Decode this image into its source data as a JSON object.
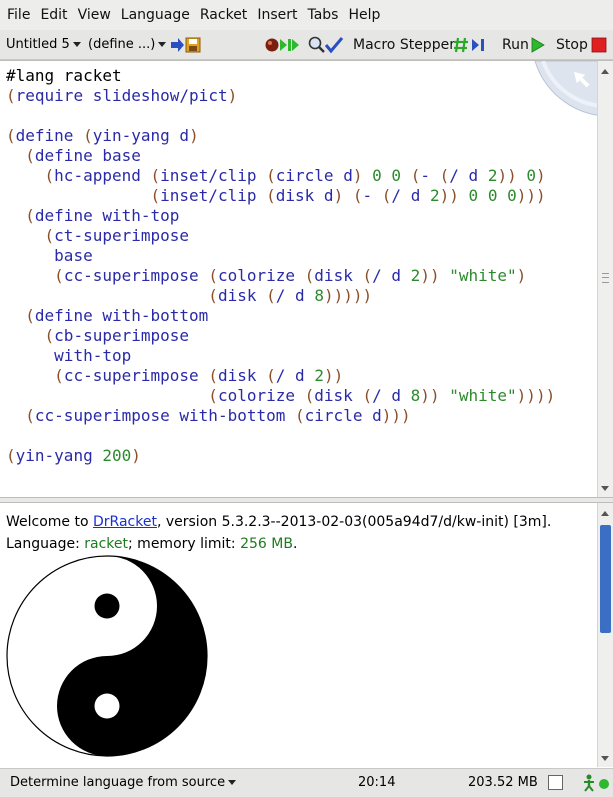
{
  "menubar": {
    "items": [
      "File",
      "Edit",
      "View",
      "Language",
      "Racket",
      "Insert",
      "Tabs",
      "Help"
    ]
  },
  "toolbar": {
    "file_dropdown": "Untitled 5",
    "define_dropdown": "(define ...)",
    "macro_stepper_label": "Macro Stepper",
    "run_label": "Run",
    "stop_label": "Stop"
  },
  "editor": {
    "lines": [
      "#lang racket",
      "(require slideshow/pict)",
      "",
      "(define (yin-yang d)",
      "  (define base",
      "    (hc-append (inset/clip (circle d) 0 0 (- (/ d 2)) 0)",
      "               (inset/clip (disk d) (- (/ d 2)) 0 0 0)))",
      "  (define with-top",
      "    (ct-superimpose",
      "     base",
      "     (cc-superimpose (colorize (disk (/ d 2)) \"white\")",
      "                     (disk (/ d 8)))))",
      "  (define with-bottom",
      "    (cb-superimpose",
      "     with-top",
      "     (cc-superimpose (disk (/ d 2))",
      "                     (colorize (disk (/ d 8)) \"white\"))))",
      "  (cc-superimpose with-bottom (circle d)))",
      "",
      "(yin-yang 200)"
    ]
  },
  "interactions": {
    "welcome_prefix": "Welcome to ",
    "welcome_link": "DrRacket",
    "welcome_suffix": ", version 5.3.2.3--2013-02-03(005a94d7/d/kw-init) [3m].",
    "language_prefix": "Language: ",
    "language_value": "racket",
    "memory_prefix": "; memory limit: ",
    "memory_value": "256 MB",
    "memory_suffix": "."
  },
  "statusbar": {
    "language_selector": "Determine language from source",
    "position": "20:14",
    "memory": "203.52 MB"
  },
  "colors": {
    "paren": "#8b4f2a",
    "identifier": "#2a2aa8",
    "literal": "#2d8a2d",
    "link": "#1a2fd0",
    "run_green": "#2db82d",
    "stop_red": "#e02020",
    "scroll_thumb": "#3a6fc4"
  }
}
